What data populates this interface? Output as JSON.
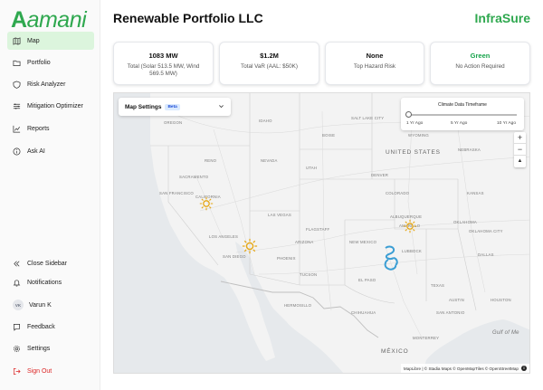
{
  "brand_logo": "amani",
  "nav": {
    "top": [
      {
        "label": "Map",
        "icon": "map-icon"
      },
      {
        "label": "Portfolio",
        "icon": "folder-icon"
      },
      {
        "label": "Risk Analyzer",
        "icon": "shield-icon"
      },
      {
        "label": "Mitigation Optimizer",
        "icon": "sliders-icon"
      },
      {
        "label": "Reports",
        "icon": "line-chart-icon"
      },
      {
        "label": "Ask AI",
        "icon": "info-circle-icon"
      }
    ],
    "bottom": {
      "close_sidebar": "Close Sidebar",
      "notifications": "Notifications",
      "user_initials": "VK",
      "user_name": "Varun K",
      "feedback": "Feedback",
      "settings": "Settings",
      "sign_out": "Sign Out"
    }
  },
  "header": {
    "title": "Renewable Portfolio LLC",
    "brand": "InfraSure"
  },
  "cards": [
    {
      "value": "1083 MW",
      "sub": "Total (Solar 513.5 MW, Wind 569.5 MW)"
    },
    {
      "value": "$1.2M",
      "sub": "Total VaR (AAL: $50K)"
    },
    {
      "value": "None",
      "sub": "Top Hazard Risk"
    },
    {
      "value": "Green",
      "sub": "No Action Required"
    }
  ],
  "map": {
    "settings_label": "Map Settings",
    "beta_badge": "Beta",
    "timeframe": {
      "title": "Climate Data Timeframe",
      "ticks": [
        "1 Yr Ago",
        "5 Yr Ago",
        "10 Yr Ago"
      ],
      "selected": "1 Yr Ago"
    },
    "zoom_in": "+",
    "zoom_out": "−",
    "reset_north": "▲",
    "labels": {
      "united_states": "UNITED STATES",
      "mexico": "MÉXICO",
      "gulf": "Gulf of Me",
      "idaho": "IDAHO",
      "oregon": "OREGON",
      "wyoming": "WYOMING",
      "nebraska": "NEBRASKA",
      "nevada": "NEVADA",
      "utah": "UTAH",
      "colorado": "COLORADO",
      "kansas": "KANSAS",
      "california": "CALIFORNIA",
      "arizona": "ARIZONA",
      "new_mexico": "NEW MEXICO",
      "oklahoma": "OKLAHOMA",
      "texas": "TEXAS",
      "salt_lake_city": "SALT LAKE CITY",
      "denver": "DENVER",
      "las_vegas": "LAS VEGAS",
      "los_angeles": "LOS ANGELES",
      "san_diego": "SAN DIEGO",
      "phoenix": "PHOENIX",
      "tucson": "TUCSON",
      "albuquerque": "ALBUQUERQUE",
      "el_paso": "EL PASO",
      "amarillo": "AMARILLO",
      "lubbock": "LUBBOCK",
      "dallas": "DALLAS",
      "austin": "AUSTIN",
      "san_antonio": "SAN ANTONIO",
      "houston": "HOUSTON",
      "oklahoma_city": "OKLAHOMA CITY",
      "reno": "RENO",
      "sacramento": "SACRAMENTO",
      "boise": "BOISE",
      "flagstaff": "FLAGSTAFF",
      "san_francisco": "SAN FRANCISCO",
      "chihuahua": "CHIHUAHUA",
      "hermosillo": "HERMOSILLO",
      "monterrey": "MONTERREY"
    },
    "attribution": "MapLibre | © Stadia Maps © OpenMapTiles © OpenStreetMap"
  },
  "colors": {
    "brand_green": "#2fa84f",
    "solar_marker": "#e6a817",
    "wind_marker": "#3b9ed4",
    "sign_out_red": "#dc2626"
  }
}
